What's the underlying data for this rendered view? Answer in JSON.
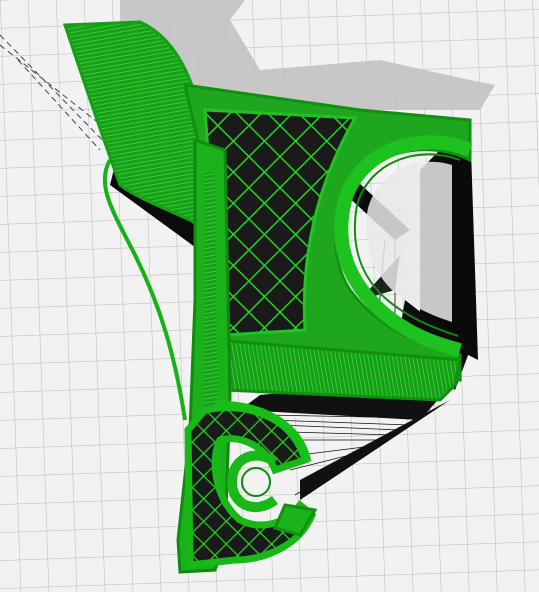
{
  "app": {
    "view": "layer preview",
    "colors": {
      "background": "#f2f2f2",
      "grid_line": "#b9b9b9",
      "shadow": "#bdbdbd",
      "extrusion_green": "#1fb21f",
      "extrusion_dark": "#0c7a0c",
      "travel_black": "#000000"
    }
  },
  "icons": {
    "model": "printed-part-icon"
  }
}
